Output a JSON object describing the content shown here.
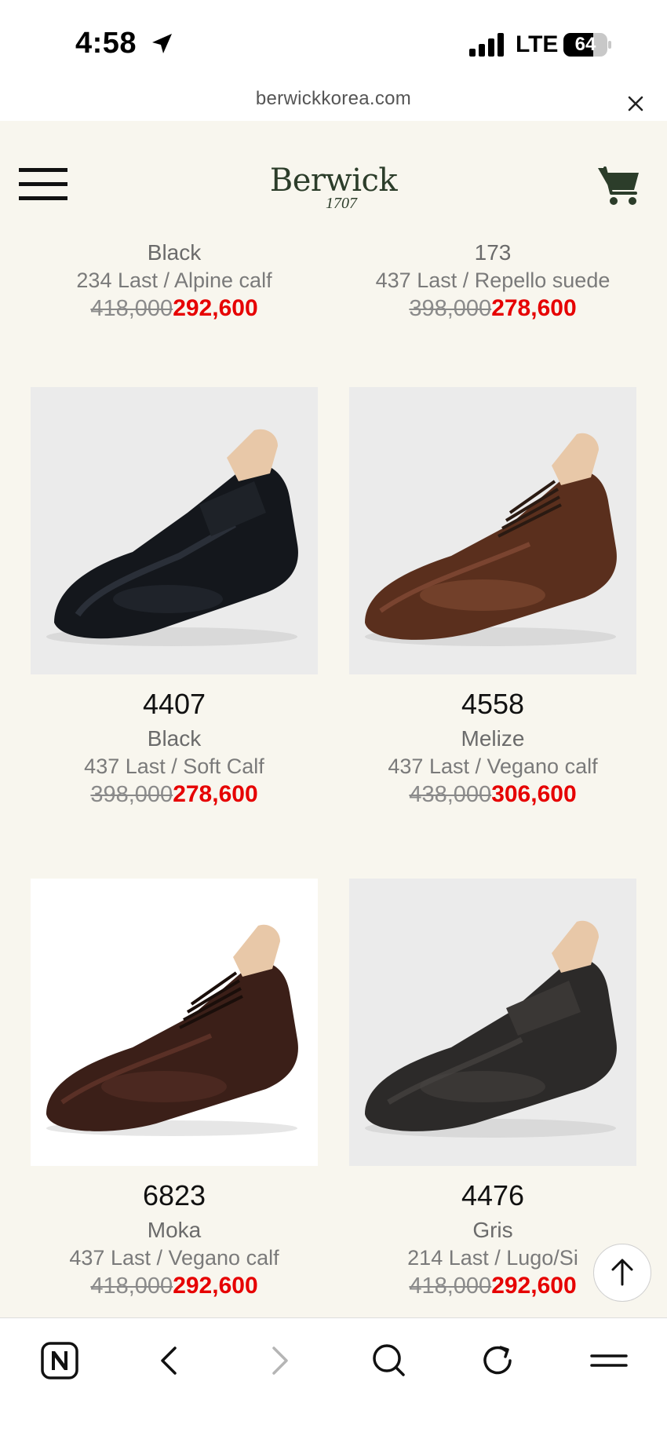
{
  "status_bar": {
    "time": "4:58",
    "network": "LTE",
    "battery": "64"
  },
  "browser": {
    "url": "berwickkorea.com"
  },
  "header": {
    "brand": "Berwick",
    "brand_year": "1707"
  },
  "partial_products": [
    {
      "color": "Black",
      "last": "234 Last / Alpine calf",
      "old_price": "418,000",
      "new_price": "292,600"
    },
    {
      "color": "173",
      "last": "437 Last / Repello suede",
      "old_price": "398,000",
      "new_price": "278,600"
    }
  ],
  "products": [
    {
      "code": "4407",
      "color": "Black",
      "last": "437 Last / Soft Calf",
      "old_price": "398,000",
      "new_price": "278,600"
    },
    {
      "code": "4558",
      "color": "Melize",
      "last": "437 Last / Vegano calf",
      "old_price": "438,000",
      "new_price": "306,600"
    },
    {
      "code": "6823",
      "color": "Moka",
      "last": "437 Last / Vegano calf",
      "old_price": "418,000",
      "new_price": "292,600"
    },
    {
      "code": "4476",
      "color": "Gris",
      "last": "214 Last / Lugo/Si",
      "old_price": "418,000",
      "new_price": "292,600"
    }
  ],
  "icons": {
    "menu": "hamburger-icon",
    "cart": "cart-icon",
    "close": "close-icon",
    "scroll_top": "arrow-up-icon",
    "toolbar": [
      "naver-icon",
      "back-icon",
      "forward-icon",
      "search-icon",
      "reload-icon",
      "menu-icon"
    ]
  },
  "colors": {
    "sale_price": "#e60000",
    "background": "#f8f6ee",
    "brand": "#2c3d2a"
  }
}
